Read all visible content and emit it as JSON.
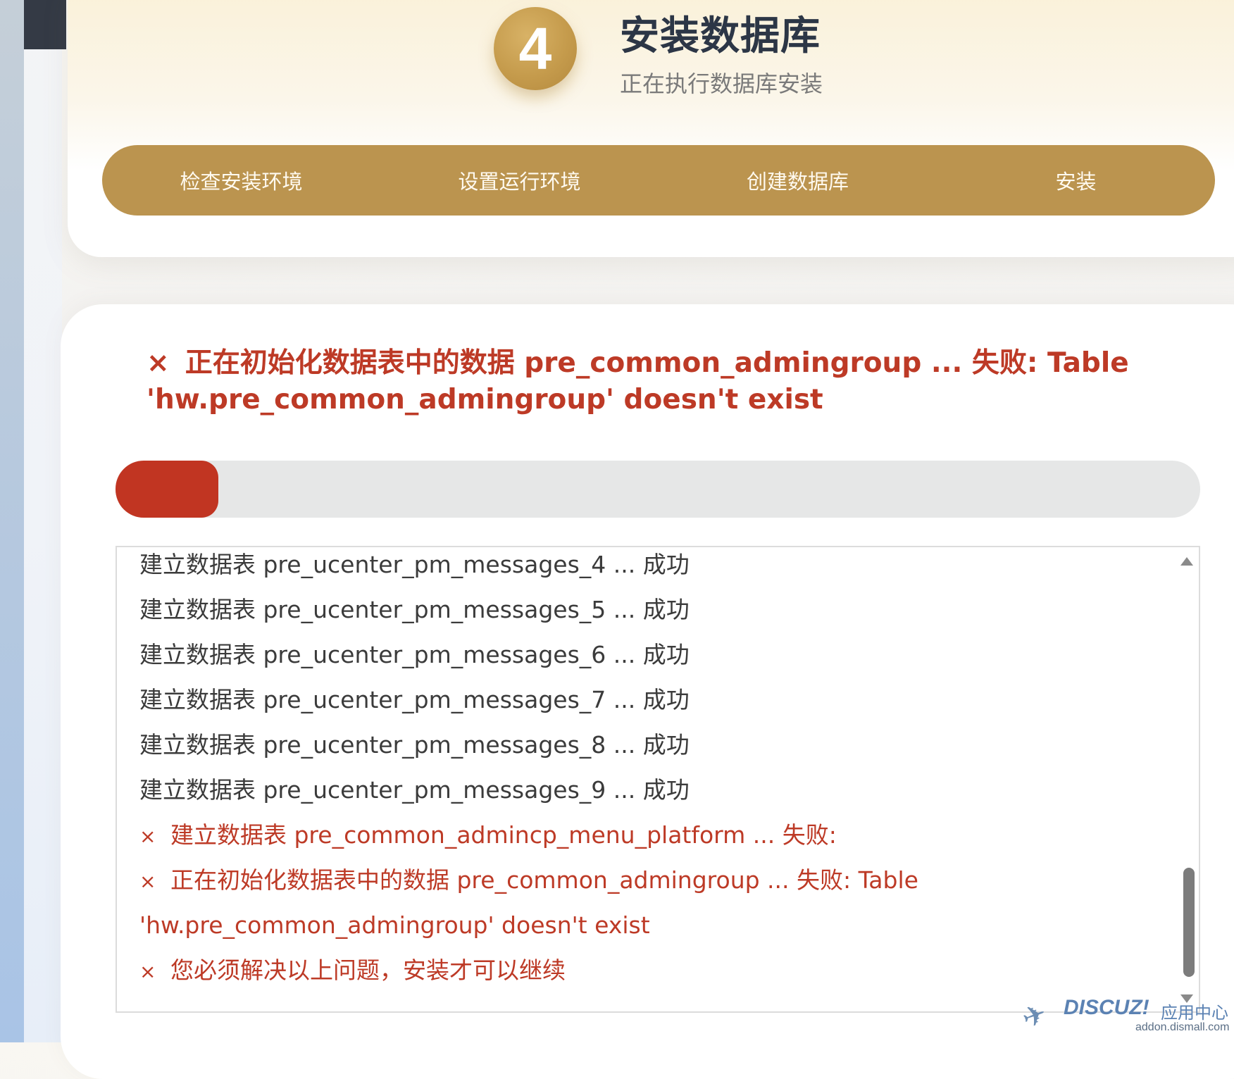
{
  "header": {
    "step_number": "4",
    "title": "安装数据库",
    "subtitle": "正在执行数据库安装",
    "nav_steps": [
      {
        "label": "检查安装环境"
      },
      {
        "label": "设置运行环境"
      },
      {
        "label": "创建数据库"
      },
      {
        "label": "安装"
      }
    ]
  },
  "status": {
    "error_icon": "×",
    "error_message": "正在初始化数据表中的数据 pre_common_admingroup ... 失败: Table 'hw.pre_common_admingroup' doesn't exist",
    "progress_fraction": 0.095
  },
  "log": {
    "lines": [
      {
        "type": "ok",
        "text": "建立数据表 pre_ucenter_pm_messages_4 ... 成功"
      },
      {
        "type": "ok",
        "text": "建立数据表 pre_ucenter_pm_messages_5 ... 成功"
      },
      {
        "type": "ok",
        "text": "建立数据表 pre_ucenter_pm_messages_6 ... 成功"
      },
      {
        "type": "ok",
        "text": "建立数据表 pre_ucenter_pm_messages_7 ... 成功"
      },
      {
        "type": "ok",
        "text": "建立数据表 pre_ucenter_pm_messages_8 ... 成功"
      },
      {
        "type": "ok",
        "text": "建立数据表 pre_ucenter_pm_messages_9 ... 成功"
      },
      {
        "type": "err",
        "icon": "×",
        "text": "建立数据表 pre_common_admincp_menu_platform ... 失败:"
      },
      {
        "type": "err",
        "icon": "×",
        "text": "正在初始化数据表中的数据 pre_common_admingroup ... 失败: Table"
      },
      {
        "type": "err",
        "text": "'hw.pre_common_admingroup' doesn't exist"
      },
      {
        "type": "err",
        "icon": "×",
        "text": "您必须解决以上问题，安装才可以继续"
      }
    ]
  },
  "watermark": {
    "brand": "DISCUZ!",
    "center": "应用中心",
    "url": "addon.dismall.com"
  },
  "colors": {
    "accent_gold": "#bb944f",
    "error_red": "#bd3a26",
    "progress_red": "#c13522"
  },
  "icons": {
    "error": "x-icon",
    "scroll_up": "triangle-up-icon",
    "scroll_down": "triangle-down-icon",
    "watermark": "paper-plane-icon"
  }
}
